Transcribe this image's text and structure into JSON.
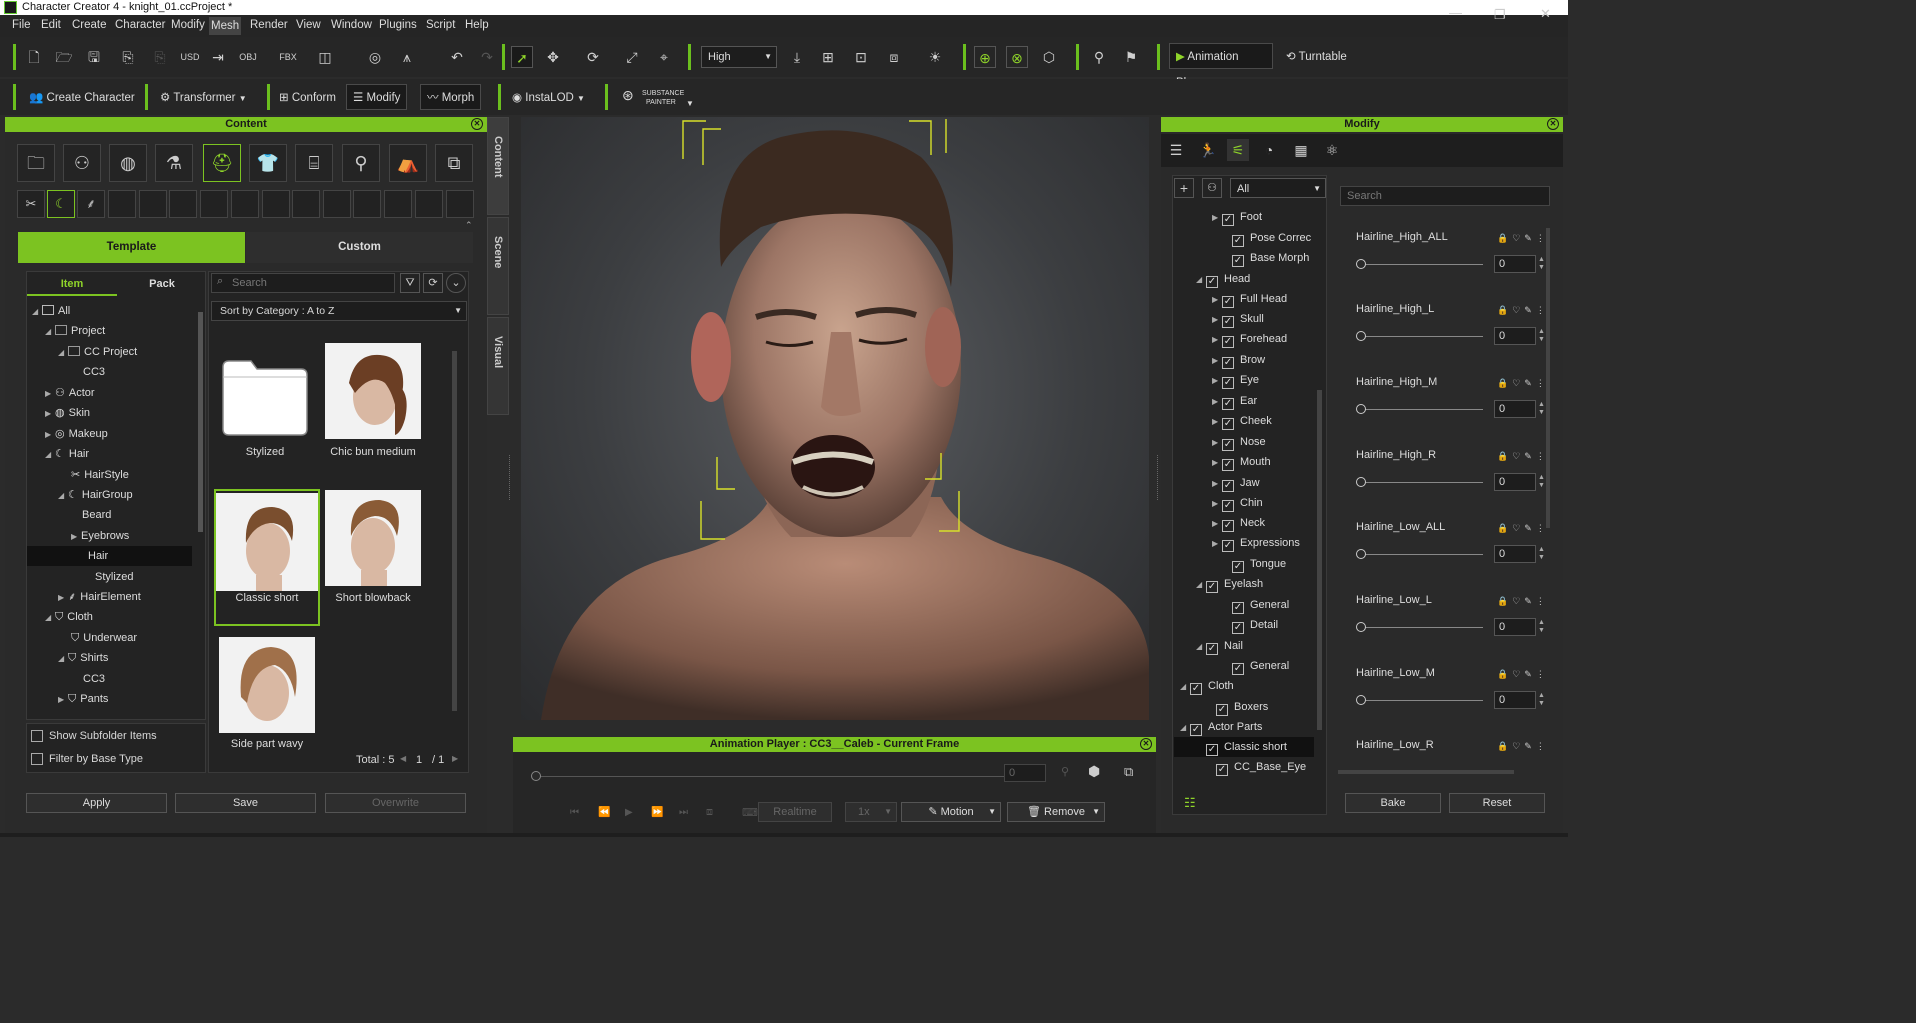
{
  "window": {
    "title": "Character Creator 4 - knight_01.ccProject *"
  },
  "menu": [
    "File",
    "Edit",
    "Create",
    "Character",
    "Modify",
    "Mesh",
    "Render",
    "View",
    "Window",
    "Plugins",
    "Script",
    "Help"
  ],
  "toolbar": {
    "quality": "High",
    "animation_player": "Animation Player",
    "turntable": "Turntable"
  },
  "toolbar2": {
    "create_character": "Create Character",
    "transformer": "Transformer",
    "conform": "Conform",
    "modify": "Modify",
    "morph": "Morph",
    "instalod": "InstaLOD",
    "substance_line1": "SUBSTANCE",
    "substance_line2": "PAINTER"
  },
  "content": {
    "header": "Content",
    "tabs": {
      "template": "Template",
      "custom": "Custom"
    },
    "subtabs": {
      "item": "Item",
      "pack": "Pack"
    },
    "search_placeholder": "Search",
    "sort": "Sort by Category : A to Z",
    "side_tabs": [
      "Content",
      "Scene",
      "Visual"
    ],
    "tree": [
      {
        "label": "All"
      },
      {
        "label": "Project"
      },
      {
        "label": "CC Project"
      },
      {
        "label": "CC3"
      },
      {
        "label": "Actor"
      },
      {
        "label": "Skin"
      },
      {
        "label": "Makeup"
      },
      {
        "label": "Hair"
      },
      {
        "label": "HairStyle"
      },
      {
        "label": "HairGroup"
      },
      {
        "label": "Beard"
      },
      {
        "label": "Eyebrows"
      },
      {
        "label": "Hair"
      },
      {
        "label": "Stylized"
      },
      {
        "label": "HairElement"
      },
      {
        "label": "Cloth"
      },
      {
        "label": "Underwear"
      },
      {
        "label": "Shirts"
      },
      {
        "label": "CC3"
      },
      {
        "label": "Pants"
      }
    ],
    "items": [
      {
        "label": "Stylized"
      },
      {
        "label": "Chic bun medium"
      },
      {
        "label": "Classic short"
      },
      {
        "label": "Short blowback"
      },
      {
        "label": "Side part wavy"
      }
    ],
    "total": "Total : 5",
    "page": "1",
    "page_total": "/ 1",
    "options": {
      "show_subfolder": "Show Subfolder Items",
      "filter_base": "Filter by Base Type"
    },
    "buttons": {
      "apply": "Apply",
      "save": "Save",
      "overwrite": "Overwrite"
    }
  },
  "anim": {
    "header": "Animation Player : CC3__Caleb - Current Frame",
    "frame": "0",
    "realtime": "Realtime",
    "speed": "1x",
    "motion": "Motion",
    "remove": "Remove"
  },
  "modify": {
    "header": "Modify",
    "filter": "All",
    "search_placeholder": "Search",
    "tree": [
      {
        "label": "Foot"
      },
      {
        "label": "Pose Correc"
      },
      {
        "label": "Base Morph"
      },
      {
        "label": "Head"
      },
      {
        "label": "Full Head"
      },
      {
        "label": "Skull"
      },
      {
        "label": "Forehead"
      },
      {
        "label": "Brow"
      },
      {
        "label": "Eye"
      },
      {
        "label": "Ear"
      },
      {
        "label": "Cheek"
      },
      {
        "label": "Nose"
      },
      {
        "label": "Mouth"
      },
      {
        "label": "Jaw"
      },
      {
        "label": "Chin"
      },
      {
        "label": "Neck"
      },
      {
        "label": "Expressions"
      },
      {
        "label": "Tongue"
      },
      {
        "label": "Eyelash"
      },
      {
        "label": "General"
      },
      {
        "label": "Detail"
      },
      {
        "label": "Nail"
      },
      {
        "label": "General"
      },
      {
        "label": "Cloth"
      },
      {
        "label": "Boxers"
      },
      {
        "label": "Actor Parts"
      },
      {
        "label": "Classic short"
      },
      {
        "label": "CC_Base_Eye"
      }
    ],
    "sliders": [
      {
        "label": "Hairline_High_ALL",
        "value": "0"
      },
      {
        "label": "Hairline_High_L",
        "value": "0"
      },
      {
        "label": "Hairline_High_M",
        "value": "0"
      },
      {
        "label": "Hairline_High_R",
        "value": "0"
      },
      {
        "label": "Hairline_Low_ALL",
        "value": "0"
      },
      {
        "label": "Hairline_Low_L",
        "value": "0"
      },
      {
        "label": "Hairline_Low_M",
        "value": "0"
      },
      {
        "label": "Hairline_Low_R",
        "value": ""
      }
    ],
    "buttons": {
      "bake": "Bake",
      "reset": "Reset"
    }
  }
}
